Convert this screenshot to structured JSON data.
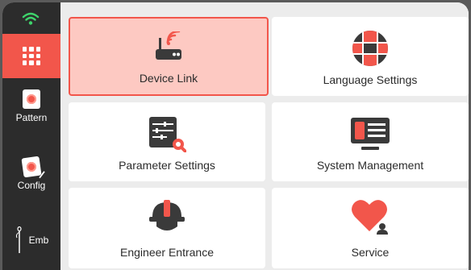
{
  "sidebar": {
    "items": [
      {
        "label": "Pattern"
      },
      {
        "label": "Config"
      },
      {
        "label": "Emb"
      }
    ]
  },
  "tiles": [
    {
      "label": "Device Link",
      "icon": "router-icon"
    },
    {
      "label": "Language Settings",
      "icon": "globe-icon"
    },
    {
      "label": "Parameter Settings",
      "icon": "parameter-settings-icon"
    },
    {
      "label": "System Management",
      "icon": "monitor-icon"
    },
    {
      "label": "Engineer Entrance",
      "icon": "hard-hat-icon"
    },
    {
      "label": "Service",
      "icon": "heart-icon"
    }
  ],
  "colors": {
    "accent": "#f2564b",
    "active_bg": "#fdc9c2",
    "sidebar": "#2c2c2c",
    "icon_dark": "#3a3a3a"
  }
}
